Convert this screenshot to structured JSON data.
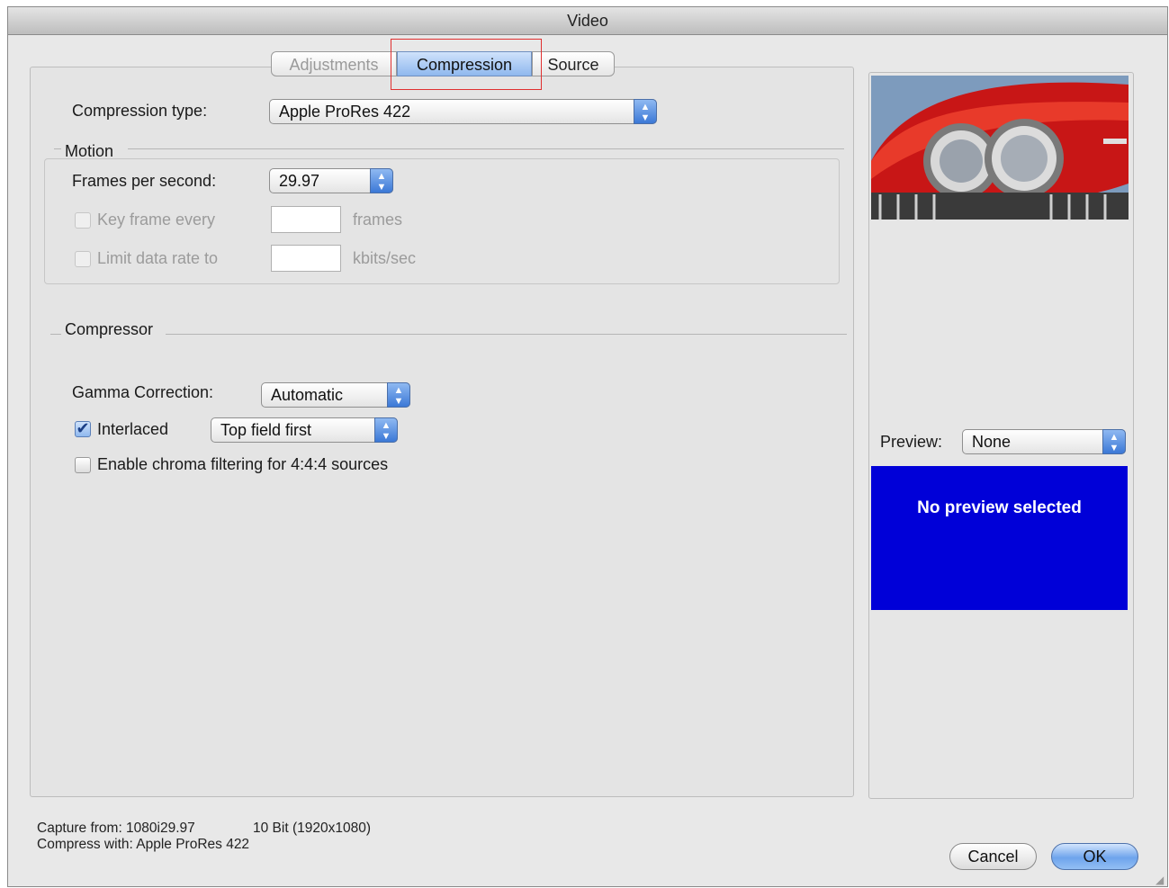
{
  "window": {
    "title": "Video"
  },
  "tabs": [
    {
      "label": "Adjustments",
      "state": "disabled"
    },
    {
      "label": "Compression",
      "state": "selected"
    },
    {
      "label": "Source",
      "state": "normal"
    }
  ],
  "compression": {
    "type_label": "Compression type:",
    "type_value": "Apple ProRes 422"
  },
  "motion": {
    "group_label": "Motion",
    "fps_label": "Frames per second:",
    "fps_value": "29.97",
    "keyframe_label": "Key frame every",
    "keyframe_value": "",
    "keyframe_unit": "frames",
    "limit_label": "Limit data rate to",
    "limit_value": "",
    "limit_unit": "kbits/sec"
  },
  "compressor": {
    "group_label": "Compressor",
    "gamma_label": "Gamma Correction:",
    "gamma_value": "Automatic",
    "interlaced_label": "Interlaced",
    "interlaced_checked": true,
    "field_order_value": "Top field first",
    "chroma_label": "Enable chroma filtering for 4:4:4 sources",
    "chroma_checked": false
  },
  "preview": {
    "label": "Preview:",
    "value": "None",
    "message": "No preview selected",
    "message_bg": "#0000d8"
  },
  "status": {
    "capture_from": "Capture from: 1080i29.97",
    "bit_depth": "10 Bit  (1920x1080)",
    "compress_with": "Compress with: Apple ProRes 422"
  },
  "buttons": {
    "cancel": "Cancel",
    "ok": "OK"
  },
  "colors": {
    "accent": "#6ea4ec",
    "highlight_box": "#e03030"
  }
}
